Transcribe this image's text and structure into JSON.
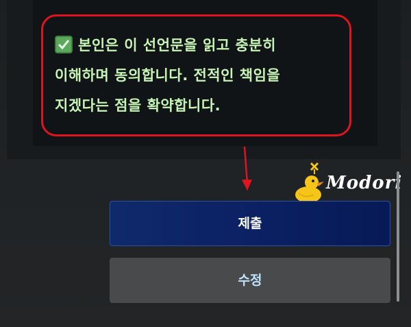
{
  "agreement": {
    "lines": [
      "본인은 이 선언문을 읽고 충분히",
      "이해하며 동의합니다. 전적인 책임을",
      "지겠다는 점을 확약합니다."
    ],
    "checked": true
  },
  "buttons": {
    "submit_label": "제출",
    "edit_label": "수정"
  },
  "watermark": {
    "text": "Modori"
  },
  "colors": {
    "callout_border": "#e0141e",
    "agree_text": "#c7f5b5",
    "submit_bg": "#0b2163",
    "edit_bg": "#484a4c"
  }
}
